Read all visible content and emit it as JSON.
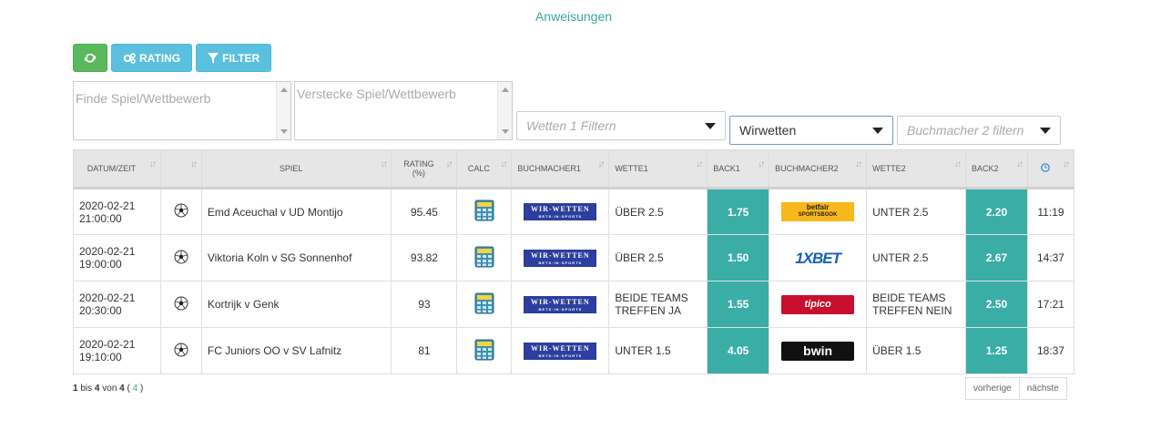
{
  "top_link": "Anweisungen",
  "toolbar": {
    "rating_label": "RATING",
    "filter_label": "FILTER"
  },
  "filters": {
    "find_placeholder": "Finde Spiel/Wettbewerb",
    "hide_placeholder": "Verstecke Spiel/Wettbewerb",
    "wette1_placeholder": "Wetten 1 Filtern",
    "bookmaker1_value": "Wirwetten",
    "bookmaker2_placeholder": "Buchmacher 2 filtern"
  },
  "table": {
    "headers": [
      "DATUM/ZEIT",
      "",
      "SPIEL",
      "RATING (%)",
      "CALC",
      "BUCHMACHER1",
      "WETTE1",
      "BACK1",
      "BUCHMACHER2",
      "WETTE2",
      "BACK2",
      ""
    ],
    "rows": [
      {
        "date": "2020-02-21",
        "time": "21:00:00",
        "match": "Emd Aceuchal v UD Montijo",
        "rating": "95.45",
        "bm1": "WIR-WETTEN",
        "bm1_sub": "BETS·IN·SPORTS",
        "wette1": "ÜBER 2.5",
        "back1": "1.75",
        "bm2": "betfair",
        "bm2_sub": "SPORTSBOOK",
        "wette2": "UNTER 2.5",
        "back2": "2.20",
        "clock": "11:19"
      },
      {
        "date": "2020-02-21",
        "time": "19:00:00",
        "match": "Viktoria Koln v SG Sonnenhof",
        "rating": "93.82",
        "bm1": "WIR-WETTEN",
        "bm1_sub": "BETS·IN·SPORTS",
        "wette1": "ÜBER 2.5",
        "back1": "1.50",
        "bm2": "1XBET",
        "bm2_sub": "",
        "wette2": "UNTER 2.5",
        "back2": "2.67",
        "clock": "14:37"
      },
      {
        "date": "2020-02-21",
        "time": "20:30:00",
        "match": "Kortrijk v Genk",
        "rating": "93",
        "bm1": "WIR-WETTEN",
        "bm1_sub": "BETS·IN·SPORTS",
        "wette1": "BEIDE TEAMS TREFFEN JA",
        "back1": "1.55",
        "bm2": "tipico",
        "bm2_sub": "",
        "wette2": "BEIDE TEAMS TREFFEN NEIN",
        "back2": "2.50",
        "clock": "17:21"
      },
      {
        "date": "2020-02-21",
        "time": "19:10:00",
        "match": "FC Juniors OO v SV Lafnitz",
        "rating": "81",
        "bm1": "WIR-WETTEN",
        "bm1_sub": "BETS·IN·SPORTS",
        "wette1": "UNTER 1.5",
        "back1": "4.05",
        "bm2": "bwin",
        "bm2_sub": "",
        "wette2": "ÜBER 1.5",
        "back2": "1.25",
        "clock": "18:37"
      }
    ]
  },
  "footer": {
    "from": "1",
    "bis": "bis",
    "to": "4",
    "von": "von",
    "total": "4",
    "filtered": "4"
  },
  "pager": {
    "prev": "vorherige",
    "next": "nächste"
  },
  "colors": {
    "accent": "#3aada7",
    "green": "#5cb85c",
    "blue": "#5bc0de"
  }
}
